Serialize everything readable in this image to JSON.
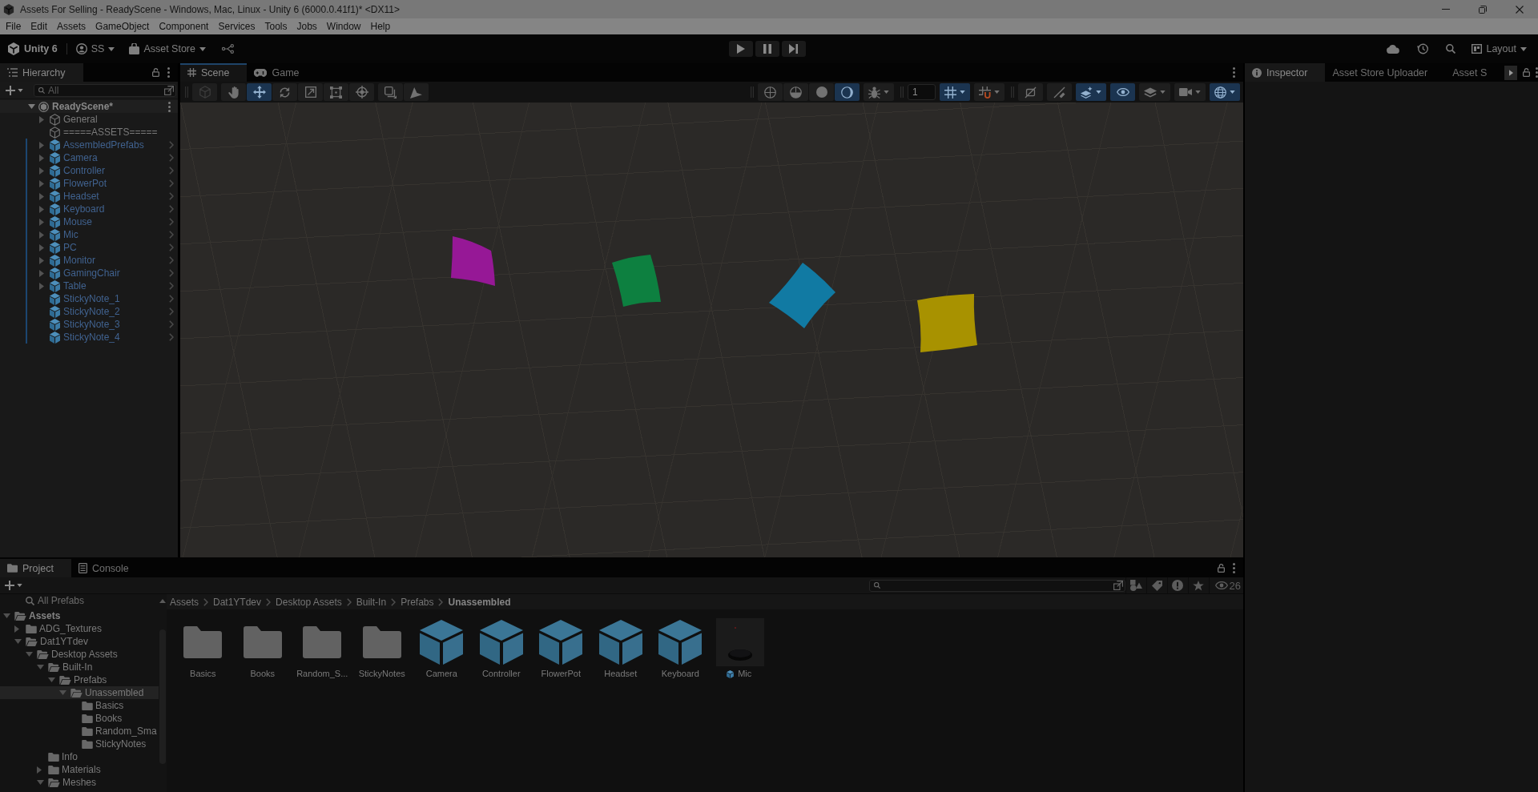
{
  "window": {
    "title": "Assets For Selling - ReadyScene - Windows, Mac, Linux - Unity 6 (6000.0.41f1)* <DX11>"
  },
  "menu_bar": [
    "File",
    "Edit",
    "Assets",
    "GameObject",
    "Component",
    "Services",
    "Tools",
    "Jobs",
    "Window",
    "Help"
  ],
  "main_toolbar": {
    "product": "Unity 6",
    "account": "SS",
    "store": "Asset Store",
    "playback": [
      {
        "kind": "play"
      },
      {
        "kind": "pause"
      },
      {
        "kind": "step"
      }
    ],
    "layout": "Layout"
  },
  "hierarchy": {
    "tabs": [
      {
        "label": "Hierarchy",
        "kind": "hierarchy",
        "selected": true
      }
    ],
    "search": {
      "placeholder": "All"
    },
    "scene": {
      "name": "ReadyScene*",
      "expanded": true,
      "children": [
        {
          "name": "General",
          "kind": "object",
          "expandable": true,
          "selected": false
        },
        {
          "name": "=====ASSETS=====",
          "kind": "object",
          "expandable": false,
          "selected": false
        },
        {
          "name": "AssembledPrefabs",
          "kind": "prefab",
          "expandable": true,
          "selected": false
        },
        {
          "name": "Camera",
          "kind": "prefab",
          "expandable": true,
          "selected": false
        },
        {
          "name": "Controller",
          "kind": "prefab",
          "expandable": true,
          "selected": false
        },
        {
          "name": "FlowerPot",
          "kind": "prefab",
          "expandable": true,
          "selected": false
        },
        {
          "name": "Headset",
          "kind": "prefab",
          "expandable": true,
          "selected": false
        },
        {
          "name": "Keyboard",
          "kind": "prefab",
          "expandable": true,
          "selected": false
        },
        {
          "name": "Mouse",
          "kind": "prefab",
          "expandable": true,
          "selected": false
        },
        {
          "name": "Mic",
          "kind": "prefab",
          "expandable": true,
          "selected": false
        },
        {
          "name": "PC",
          "kind": "prefab",
          "expandable": true,
          "selected": false
        },
        {
          "name": "Monitor",
          "kind": "prefab",
          "expandable": true,
          "selected": false
        },
        {
          "name": "GamingChair",
          "kind": "prefab",
          "expandable": true,
          "selected": false
        },
        {
          "name": "Table",
          "kind": "prefab",
          "expandable": true,
          "selected": false
        },
        {
          "name": "StickyNote_1",
          "kind": "prefab",
          "expandable": false,
          "selected": false
        },
        {
          "name": "StickyNote_2",
          "kind": "prefab",
          "expandable": false,
          "selected": false
        },
        {
          "name": "StickyNote_3",
          "kind": "prefab",
          "expandable": false,
          "selected": false
        },
        {
          "name": "StickyNote_4",
          "kind": "prefab",
          "expandable": false,
          "selected": false
        }
      ]
    }
  },
  "scene_panel": {
    "tabs": [
      {
        "label": "Scene",
        "kind": "scene",
        "selected": true
      },
      {
        "label": "Game",
        "kind": "game",
        "selected": false
      }
    ],
    "tool_overlays": [
      [
        [
          {
            "kind": "view",
            "selected": false,
            "disabled": true
          }
        ],
        [
          {
            "kind": "hand",
            "selected": false,
            "disabled": false
          },
          {
            "kind": "move",
            "selected": true,
            "disabled": false
          },
          {
            "kind": "rotate",
            "selected": false,
            "disabled": false
          },
          {
            "kind": "scale",
            "selected": false,
            "disabled": false
          },
          {
            "kind": "rect",
            "selected": false,
            "disabled": false
          },
          {
            "kind": "transform",
            "selected": false,
            "disabled": false
          }
        ],
        [
          {
            "kind": "overlay",
            "selected": false,
            "disabled": false
          },
          {
            "kind": "custom",
            "selected": false,
            "disabled": false
          }
        ]
      ]
    ],
    "view_overlays": [
      [
        [
          {
            "kind": "wire",
            "selected": false,
            "dropdown": false
          },
          {
            "kind": "shaded",
            "selected": false,
            "dropdown": false
          },
          {
            "kind": "sphere",
            "selected": false,
            "dropdown": false
          },
          {
            "kind": "lighting",
            "selected": true,
            "dropdown": false
          }
        ],
        [
          {
            "kind": "debug",
            "selected": false,
            "dropdown": true
          }
        ]
      ],
      [
        [
          {
            "kind": "field",
            "value": "1"
          }
        ],
        [
          {
            "kind": "grid",
            "selected": true,
            "dropdown": true
          }
        ],
        [
          {
            "kind": "snap",
            "selected": false,
            "dropdown": true
          }
        ]
      ],
      [
        [
          {
            "kind": "hide2d",
            "selected": false,
            "dropdown": false
          }
        ],
        [
          {
            "kind": "mute",
            "selected": false,
            "dropdown": false
          }
        ],
        [
          {
            "kind": "effects",
            "selected": true,
            "dropdown": true
          }
        ],
        [
          {
            "kind": "visibility",
            "selected": true,
            "dropdown": false
          }
        ],
        [
          {
            "kind": "layers",
            "selected": false,
            "dropdown": true
          }
        ],
        [
          {
            "kind": "camera",
            "selected": false,
            "dropdown": true
          }
        ],
        [
          {
            "kind": "gizmos",
            "selected": true,
            "dropdown": true
          }
        ]
      ]
    ],
    "objects": [
      {
        "color": "#961896"
      },
      {
        "color": "#0d8040"
      },
      {
        "color": "#117aa3"
      },
      {
        "color": "#a89200"
      }
    ]
  },
  "inspector": {
    "tabs": [
      {
        "label": "Inspector",
        "kind": "inspector",
        "selected": true
      },
      {
        "label": "Asset Store Uploader",
        "kind": "tool",
        "selected": false
      },
      {
        "label": "Asset S",
        "kind": "tool",
        "selected": false
      }
    ]
  },
  "project": {
    "tabs": [
      {
        "label": "Project",
        "kind": "project",
        "selected": true
      },
      {
        "label": "Console",
        "kind": "console",
        "selected": false
      }
    ],
    "hidden_count": "26",
    "tree": {
      "saved_search": "All Prefabs",
      "folders": [
        {
          "name": "Assets",
          "expandable": true,
          "expanded": true,
          "selected": false,
          "children": [
            {
              "name": "ADG_Textures",
              "expandable": true,
              "expanded": false,
              "selected": false
            },
            {
              "name": "Dat1YTdev",
              "expandable": true,
              "expanded": true,
              "selected": false,
              "children": [
                {
                  "name": "Desktop Assets",
                  "expandable": true,
                  "expanded": true,
                  "selected": false,
                  "children": [
                    {
                      "name": "Built-In",
                      "expandable": true,
                      "expanded": true,
                      "selected": false,
                      "children": [
                        {
                          "name": "Prefabs",
                          "expandable": true,
                          "expanded": true,
                          "selected": false,
                          "children": [
                            {
                              "name": "Unassembled",
                              "expandable": true,
                              "expanded": true,
                              "selected": true,
                              "children": [
                                {
                                  "name": "Basics",
                                  "expandable": false,
                                  "expanded": false,
                                  "selected": false
                                },
                                {
                                  "name": "Books",
                                  "expandable": false,
                                  "expanded": false,
                                  "selected": false
                                },
                                {
                                  "name": "Random_Sma",
                                  "expandable": false,
                                  "expanded": false,
                                  "selected": false
                                },
                                {
                                  "name": "StickyNotes",
                                  "expandable": false,
                                  "expanded": false,
                                  "selected": false
                                }
                              ]
                            }
                          ]
                        }
                      ]
                    },
                    {
                      "name": "Info",
                      "expandable": false,
                      "expanded": false,
                      "selected": false
                    },
                    {
                      "name": "Materials",
                      "expandable": true,
                      "expanded": false,
                      "selected": false
                    },
                    {
                      "name": "Meshes",
                      "expandable": true,
                      "expanded": true,
                      "selected": false
                    }
                  ]
                }
              ]
            }
          ]
        }
      ]
    },
    "breadcrumb": [
      "Assets",
      "Dat1YTdev",
      "Desktop Assets",
      "Built-In",
      "Prefabs",
      "Unassembled"
    ],
    "assets": [
      {
        "name": "Basics",
        "kind": "folder",
        "selected": false
      },
      {
        "name": "Books",
        "kind": "folder",
        "selected": false
      },
      {
        "name": "Random_S...",
        "kind": "folder",
        "selected": false
      },
      {
        "name": "StickyNotes",
        "kind": "folder",
        "selected": false
      },
      {
        "name": "Camera",
        "kind": "prefab",
        "selected": false
      },
      {
        "name": "Controller",
        "kind": "prefab",
        "selected": false
      },
      {
        "name": "FlowerPot",
        "kind": "prefab",
        "selected": false
      },
      {
        "name": "Headset",
        "kind": "prefab",
        "selected": false
      },
      {
        "name": "Keyboard",
        "kind": "prefab",
        "selected": false
      },
      {
        "name": "Mic",
        "kind": "model",
        "selected": false
      }
    ]
  }
}
